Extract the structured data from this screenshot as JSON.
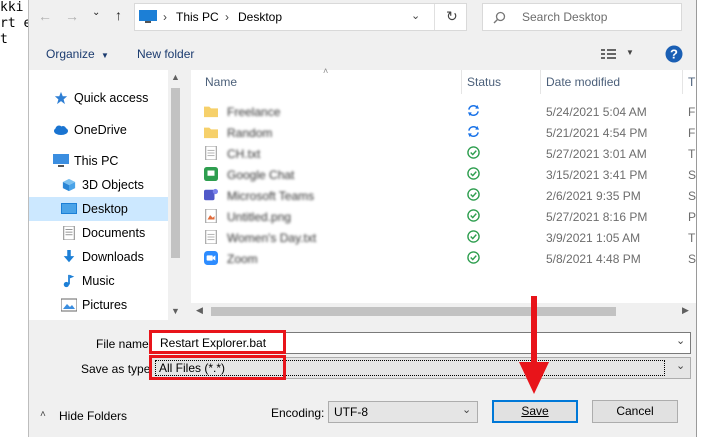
{
  "background_notepad": {
    "lines": [
      "kki",
      "rt e",
      "t"
    ]
  },
  "address": {
    "path": [
      "This PC",
      "Desktop"
    ],
    "search_placeholder": "Search Desktop"
  },
  "toolbar": {
    "organize": "Organize",
    "new_folder": "New folder"
  },
  "nav": {
    "items": [
      {
        "label": "Quick access",
        "icon": "star-icon"
      },
      {
        "label": "OneDrive",
        "icon": "cloud-icon"
      },
      {
        "label": "This PC",
        "icon": "computer-icon"
      },
      {
        "label": "3D Objects",
        "icon": "cube-icon"
      },
      {
        "label": "Desktop",
        "icon": "desktop-icon",
        "selected": true
      },
      {
        "label": "Documents",
        "icon": "document-icon"
      },
      {
        "label": "Downloads",
        "icon": "download-icon"
      },
      {
        "label": "Music",
        "icon": "music-icon"
      },
      {
        "label": "Pictures",
        "icon": "pictures-icon"
      }
    ]
  },
  "columns": {
    "name": "Name",
    "status": "Status",
    "date": "Date modified",
    "type": "T"
  },
  "files": [
    {
      "name": "Freelance",
      "date": "5/24/2021 5:04 AM",
      "type": "F",
      "icon": "folder-icon",
      "status": "sync"
    },
    {
      "name": "Random",
      "date": "5/21/2021 4:54 PM",
      "type": "F",
      "icon": "folder-icon",
      "status": "sync"
    },
    {
      "name": "CH.txt",
      "date": "5/27/2021 3:01 AM",
      "type": "T",
      "icon": "text-file-icon",
      "status": "ok"
    },
    {
      "name": "Google Chat",
      "date": "3/15/2021 3:41 PM",
      "type": "S",
      "icon": "google-chat-icon",
      "status": "ok"
    },
    {
      "name": "Microsoft Teams",
      "date": "2/6/2021 9:35 PM",
      "type": "S",
      "icon": "teams-icon",
      "status": "ok"
    },
    {
      "name": "Untitled.png",
      "date": "5/27/2021 8:16 PM",
      "type": "P",
      "icon": "image-file-icon",
      "status": "ok"
    },
    {
      "name": "Women's Day.txt",
      "date": "3/9/2021 1:05 AM",
      "type": "T",
      "icon": "text-file-icon",
      "status": "ok"
    },
    {
      "name": "Zoom",
      "date": "5/8/2021 4:48 PM",
      "type": "S",
      "icon": "zoom-icon",
      "status": "ok"
    }
  ],
  "form": {
    "file_name_label": "File name:",
    "file_name_value": "Restart Explorer.bat",
    "save_type_label": "Save as type:",
    "save_type_value": "All Files  (*.*)",
    "hide_folders": "Hide Folders",
    "encoding_label": "Encoding:",
    "encoding_value": "UTF-8",
    "save": "Save",
    "cancel": "Cancel"
  },
  "colors": {
    "highlight": "#e8141a",
    "selection": "#cce8ff",
    "sync": "#1a73e8",
    "ok": "#2e9e4f"
  }
}
